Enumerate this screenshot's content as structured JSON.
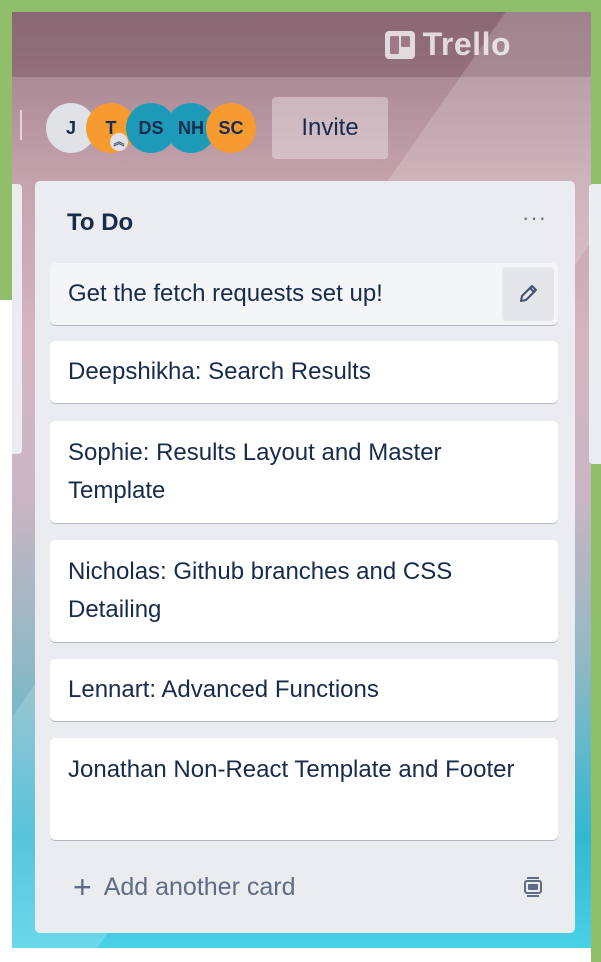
{
  "header": {
    "logo_text": "Trello"
  },
  "members": [
    {
      "initials": "J",
      "color": "#dfe1e6"
    },
    {
      "initials": "T",
      "color": "#f79a2f",
      "admin": true
    },
    {
      "initials": "DS",
      "color": "#1d9ab8"
    },
    {
      "initials": "NH",
      "color": "#1d9ab8"
    },
    {
      "initials": "SC",
      "color": "#f79a2f"
    }
  ],
  "invite_label": "Invite",
  "list": {
    "title": "To Do",
    "menu_glyph": "···",
    "cards": [
      "Get the fetch requests set up!",
      "Deepshikha: Search Results",
      "Sophie: Results Layout and Master Template",
      "Nicholas: Github branches and CSS Detailing",
      "Lennart: Advanced Functions",
      "Jonathan Non-React Template and Footer"
    ],
    "add_card_label": "Add another card"
  }
}
